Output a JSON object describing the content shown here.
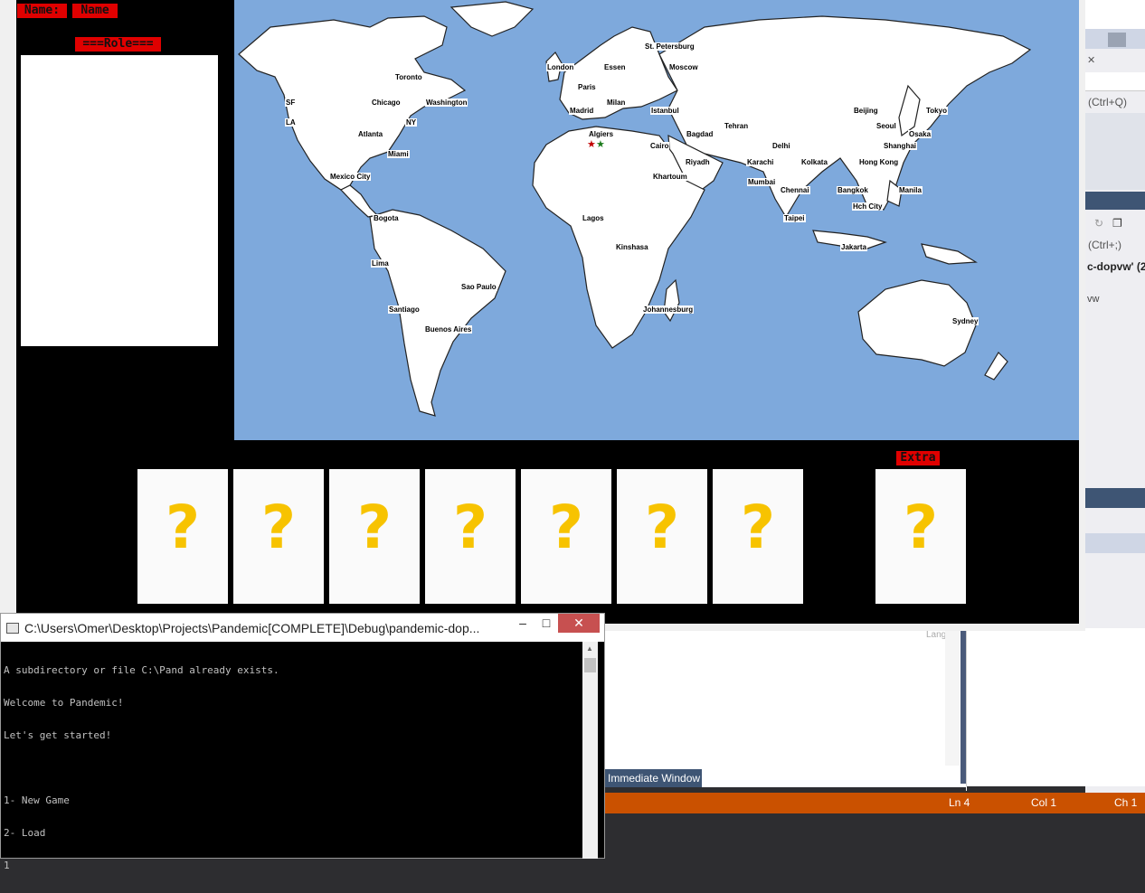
{
  "game": {
    "name_label": "Name:",
    "name_value": "Name",
    "role_label": "===Role===",
    "extra_label": "Extra",
    "cards": [
      "?",
      "?",
      "?",
      "?",
      "?",
      "?",
      "?"
    ],
    "extra_card": "?",
    "cities": [
      {
        "name": "St. Petersburg"
      },
      {
        "name": "London"
      },
      {
        "name": "Essen"
      },
      {
        "name": "Moscow"
      },
      {
        "name": "Toronto"
      },
      {
        "name": "Paris"
      },
      {
        "name": "SF"
      },
      {
        "name": "Chicago"
      },
      {
        "name": "Washington"
      },
      {
        "name": "Madrid"
      },
      {
        "name": "Milan"
      },
      {
        "name": "Istanbul"
      },
      {
        "name": "Beijing"
      },
      {
        "name": "Tokyo"
      },
      {
        "name": "LA"
      },
      {
        "name": "NY"
      },
      {
        "name": "Tehran"
      },
      {
        "name": "Seoul"
      },
      {
        "name": "Atlanta"
      },
      {
        "name": "Algiers"
      },
      {
        "name": "Bagdad"
      },
      {
        "name": "Osaka"
      },
      {
        "name": "Cairo"
      },
      {
        "name": "Delhi"
      },
      {
        "name": "Shanghai"
      },
      {
        "name": "Miami"
      },
      {
        "name": "Riyadh"
      },
      {
        "name": "Karachi"
      },
      {
        "name": "Kolkata"
      },
      {
        "name": "Hong Kong"
      },
      {
        "name": "Mexico City"
      },
      {
        "name": "Khartoum"
      },
      {
        "name": "Mumbai"
      },
      {
        "name": "Chennai"
      },
      {
        "name": "Bangkok"
      },
      {
        "name": "Manila"
      },
      {
        "name": "Hch City"
      },
      {
        "name": "Bogota"
      },
      {
        "name": "Lagos"
      },
      {
        "name": "Taipei"
      },
      {
        "name": "Kinshasa"
      },
      {
        "name": "Jakarta"
      },
      {
        "name": "Lima"
      },
      {
        "name": "Sao Paulo"
      },
      {
        "name": "Santiago"
      },
      {
        "name": "Johannesburg"
      },
      {
        "name": "Sydney"
      },
      {
        "name": "Buenos Aires"
      }
    ],
    "colors": {
      "label_red": "#e00000",
      "card_question": "#f7c300",
      "ocean": "#7ea9dc"
    }
  },
  "console": {
    "title": "C:\\Users\\Omer\\Desktop\\Projects\\Pandemic[COMPLETE]\\Debug\\pandemic-dop...",
    "minimize": "–",
    "maximize": "□",
    "close": "✕",
    "lines": [
      "A subdirectory or file C:\\Pand already exists.",
      "Welcome to Pandemic!",
      "Let's get started!",
      "",
      "1- New Game",
      "2- Load",
      "1"
    ]
  },
  "ide": {
    "search_hint": "(Ctrl+Q)",
    "search_hint2": "(Ctrl+;)",
    "project_fragment": "c-dopvw' (2",
    "vw_fragment": "vw",
    "lang_fragment": "Lang",
    "immediate_tab": "Immediate Window",
    "status": {
      "ln": "Ln 4",
      "col": "Col 1",
      "ch": "Ch 1"
    },
    "status_color": "#ca5100"
  }
}
